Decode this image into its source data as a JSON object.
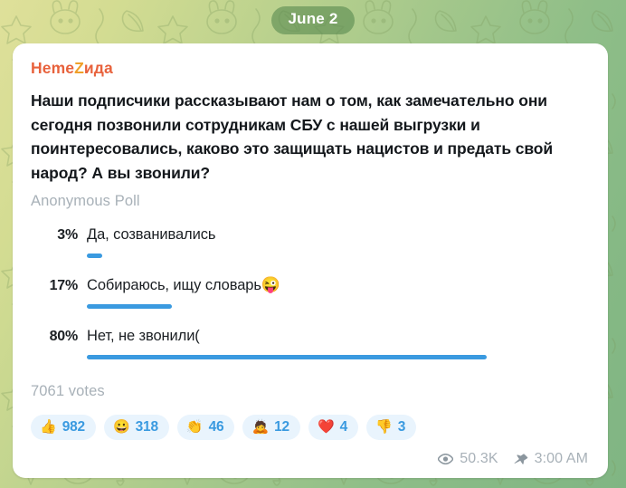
{
  "wallpaper": {
    "gradient_from": "#dfe09a",
    "gradient_to": "#80b583",
    "doodle_color": "#8aa86a"
  },
  "date_badge": {
    "label": "June 2"
  },
  "message": {
    "channel_name_prefix": "Heme",
    "channel_name_accent": "Z",
    "channel_name_suffix": "ида",
    "channel_name_full": "НемеZида",
    "channel_color": "#e8623c",
    "text": "Наши подписчики рассказывают нам о том, как замечательно они сегодня позвонили сотрудникам СБУ с нашей выгрузки и поинтересовались, каково это защищать нацистов и предать свой народ? А вы звонили?"
  },
  "poll": {
    "type_label": "Anonymous Poll",
    "bar_color": "#3a9ae0",
    "options": [
      {
        "percent": "3%",
        "percent_value": 3,
        "answer": "Да, созванивались",
        "emoji": ""
      },
      {
        "percent": "17%",
        "percent_value": 17,
        "answer": "Собираюсь, ищу словарь",
        "emoji": "😜"
      },
      {
        "percent": "80%",
        "percent_value": 80,
        "answer": "Нет, не звонили(",
        "emoji": ""
      }
    ],
    "votes_label": "7061 votes"
  },
  "reactions": [
    {
      "icon": "thumbs-up-emoji",
      "emoji": "👍",
      "count": "982"
    },
    {
      "icon": "grinning-face-emoji",
      "emoji": "😀",
      "count": "318"
    },
    {
      "icon": "clapping-hands-emoji",
      "emoji": "👏",
      "count": "46"
    },
    {
      "icon": "person-kneeling-emoji",
      "emoji": "🙇",
      "count": "12"
    },
    {
      "icon": "red-heart-emoji",
      "emoji": "❤️",
      "count": "4"
    },
    {
      "icon": "thumbs-down-emoji",
      "emoji": "👎",
      "count": "3"
    }
  ],
  "footer": {
    "views": "50.3K",
    "time": "3:00 AM"
  }
}
